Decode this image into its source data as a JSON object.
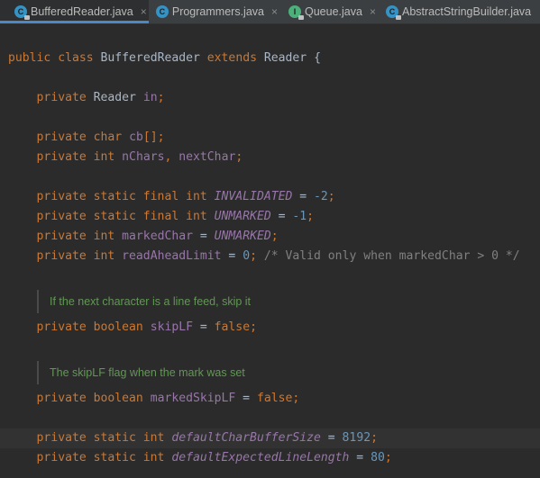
{
  "tabs": [
    {
      "label": "BufferedReader.java",
      "icon": "class-icon",
      "active": true
    },
    {
      "label": "Programmers.java",
      "icon": "class-icon",
      "active": false
    },
    {
      "label": "Queue.java",
      "icon": "interface-icon",
      "active": false
    },
    {
      "label": "AbstractStringBuilder.java",
      "icon": "class-icon",
      "active": false
    }
  ],
  "tab_close_glyph": "×",
  "code": {
    "class_decl": {
      "kw_public": "public",
      "kw_class": "class",
      "name": "BufferedReader",
      "kw_extends": "extends",
      "super": "Reader",
      "brace": "{"
    },
    "in_decl": {
      "kw": "private",
      "type": "Reader",
      "field": "in",
      "end": ";"
    },
    "cb_decl": {
      "kw": "private",
      "type": "char",
      "field": "cb",
      "brackets": "[]",
      "end": ";"
    },
    "nchars_decl": {
      "kw": "private",
      "type": "int",
      "field1": "nChars",
      "sep": ", ",
      "field2": "nextChar",
      "end": ";"
    },
    "invalidated_decl": {
      "kw": "private static final int",
      "const": "INVALIDATED",
      "eq": " = ",
      "value": "-2",
      "end": ";"
    },
    "unmarked_decl": {
      "kw": "private static final int",
      "const": "UNMARKED",
      "eq": " = ",
      "value": "-1",
      "end": ";"
    },
    "markedchar_decl": {
      "kw": "private int",
      "field": "markedChar",
      "eq": " = ",
      "const": "UNMARKED",
      "end": ";"
    },
    "readahead_decl": {
      "kw": "private int",
      "field": "readAheadLimit",
      "eq": " = ",
      "value": "0",
      "end": ";",
      "comment": " /* Valid only when markedChar > 0 */"
    },
    "skiplf_doc": "If the next character is a line feed, skip it",
    "skiplf_decl": {
      "kw": "private boolean",
      "field": "skipLF",
      "eq": " = ",
      "value": "false",
      "end": ";"
    },
    "markedskiplf_doc": "The skipLF flag when the mark was set",
    "markedskiplf_decl": {
      "kw": "private boolean",
      "field": "markedSkipLF",
      "eq": " = ",
      "value": "false",
      "end": ";"
    },
    "bufsize_decl": {
      "kw": "private static int",
      "const": "defaultCharBufferSize",
      "eq": " = ",
      "value": "8192",
      "end": ";"
    },
    "linelen_decl": {
      "kw": "private static int",
      "const": "defaultExpectedLineLength",
      "eq": " = ",
      "value": "80",
      "end": ";"
    }
  },
  "colors": {
    "keyword": "#cc7832",
    "field": "#9876aa",
    "number": "#6897bb",
    "comment": "#808080",
    "doc": "#629755",
    "text": "#a9b7c6",
    "background": "#2b2b2b",
    "tab_accent": "#4a88c7"
  }
}
